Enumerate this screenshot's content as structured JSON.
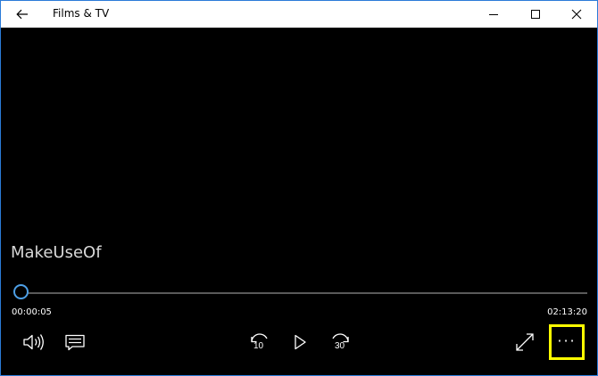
{
  "window": {
    "title": "Films & TV"
  },
  "player": {
    "video_title": "MakeUseOf",
    "elapsed": "00:00:05",
    "total": "02:13:20",
    "progress_fraction": 0.0006,
    "rewind_seconds": "10",
    "forward_seconds": "30",
    "more_label": "···",
    "highlight_color": "#ffff00",
    "accent_color": "#4d9fe6"
  },
  "icons": {
    "back": "back-arrow-icon",
    "minimize": "minimize-icon",
    "maximize": "maximize-icon",
    "close": "close-icon",
    "volume": "volume-icon",
    "subtitles": "subtitles-icon",
    "rewind": "rewind-10-icon",
    "play": "play-icon",
    "forward": "forward-30-icon",
    "fullscreen": "fullscreen-icon",
    "more": "more-options-icon"
  }
}
